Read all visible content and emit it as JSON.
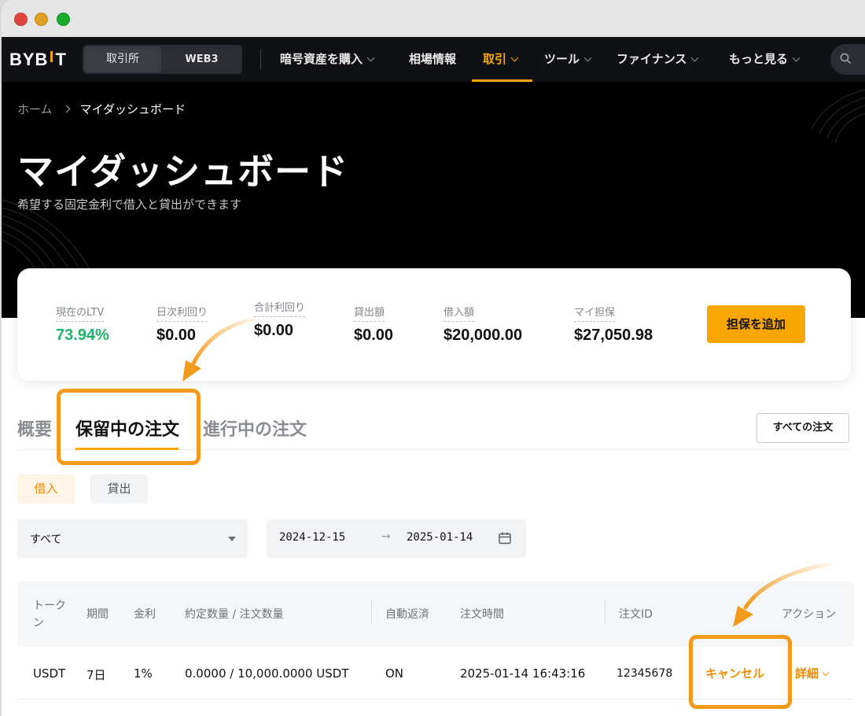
{
  "nav": {
    "logo_left": "BYB",
    "logo_right": "T",
    "segment": [
      "取引所",
      "WEB3"
    ],
    "items": [
      {
        "label": "暗号資産を購入",
        "chevron": true
      },
      {
        "label": "相場情報",
        "chevron": false
      },
      {
        "label": "取引",
        "chevron": true,
        "active": true
      },
      {
        "label": "ツール",
        "chevron": true
      },
      {
        "label": "ファイナンス",
        "chevron": true
      },
      {
        "label": "もっと見る",
        "chevron": true
      }
    ],
    "accent": "#f7a600"
  },
  "breadcrumb": {
    "home": "ホーム",
    "current": "マイダッシュボード"
  },
  "hero": {
    "title": "マイダッシュボード",
    "subtitle": "希望する固定金利で借入と貸出ができます"
  },
  "stats": [
    {
      "label": "現在のLTV",
      "value": "73.94%"
    },
    {
      "label": "日次利回り",
      "value": "$0.00"
    },
    {
      "label": "合計利回り",
      "value": "$0.00"
    },
    {
      "label": "貸出額",
      "value": "$0.00"
    },
    {
      "label": "借入額",
      "value": "$20,000.00"
    },
    {
      "label": "マイ担保",
      "value": "$27,050.98"
    }
  ],
  "add_collateral_label": "担保を追加",
  "tabs": [
    "概要",
    "保留中の注文",
    "進行中の注文"
  ],
  "all_orders_label": "すべての注文",
  "sub_tabs": [
    "借入",
    "貸出"
  ],
  "filter": {
    "select_value": "すべて",
    "date_from": "2024-12-15",
    "date_arrow": "→",
    "date_to": "2025-01-14"
  },
  "table": {
    "headers": [
      "トークン",
      "期間",
      "金利",
      "約定数量 / 注文数量",
      "自動返済",
      "注文時間",
      "注文ID",
      "アクション"
    ],
    "header_token_lines": [
      "トーク",
      "ン"
    ],
    "rows": [
      {
        "token": "USDT",
        "term": "7日",
        "rate": "1%",
        "quantity": "0.0000 / 10,000.0000 USDT",
        "auto_repay": "ON",
        "time": "2025-01-14 16:43:16",
        "order_id": "12345678",
        "cancel": "キャンセル",
        "detail": "詳細"
      }
    ]
  },
  "highlight_color": "#f29a1c"
}
